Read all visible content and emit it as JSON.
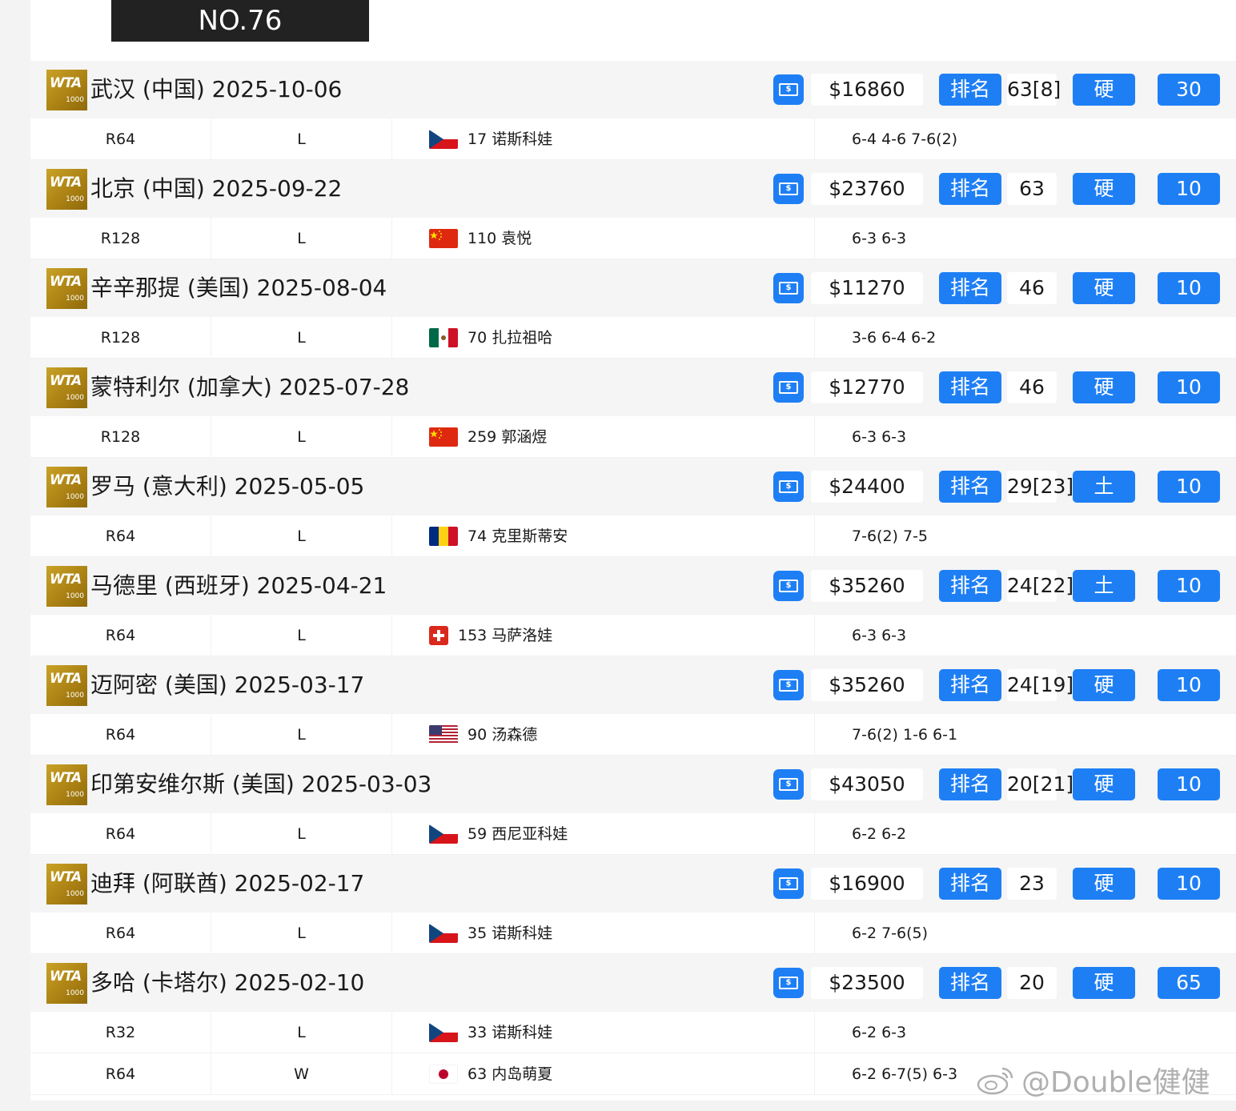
{
  "rank_badge": "NO.76",
  "logo": {
    "brand": "WTA",
    "tier": "1000"
  },
  "labels": {
    "rank": "排名"
  },
  "colors": {
    "accent": "#1e7ff5",
    "badge_bg": "#222222",
    "logo_gold": "#b8901a"
  },
  "tournaments": [
    {
      "title": "武汉 (中国) 2025-10-06",
      "prize": "$16860",
      "rank": "63[8]",
      "surface": "硬",
      "points": "30",
      "matches": [
        {
          "round": "R64",
          "result": "L",
          "flag": "cz",
          "opponent": "17 诺斯科娃",
          "score": "6-4 4-6 7-6(2)"
        }
      ]
    },
    {
      "title": "北京 (中国) 2025-09-22",
      "prize": "$23760",
      "rank": "63",
      "surface": "硬",
      "points": "10",
      "matches": [
        {
          "round": "R128",
          "result": "L",
          "flag": "cn",
          "opponent": "110 袁悦",
          "score": "6-3 6-3"
        }
      ]
    },
    {
      "title": "辛辛那提 (美国) 2025-08-04",
      "prize": "$11270",
      "rank": "46",
      "surface": "硬",
      "points": "10",
      "matches": [
        {
          "round": "R128",
          "result": "L",
          "flag": "mx",
          "opponent": "70 扎拉祖哈",
          "score": "3-6 6-4 6-2"
        }
      ]
    },
    {
      "title": "蒙特利尔 (加拿大) 2025-07-28",
      "prize": "$12770",
      "rank": "46",
      "surface": "硬",
      "points": "10",
      "matches": [
        {
          "round": "R128",
          "result": "L",
          "flag": "cn",
          "opponent": "259 郭涵煜",
          "score": "6-3 6-3"
        }
      ]
    },
    {
      "title": "罗马 (意大利) 2025-05-05",
      "prize": "$24400",
      "rank": "29[23]",
      "surface": "土",
      "points": "10",
      "matches": [
        {
          "round": "R64",
          "result": "L",
          "flag": "ro",
          "opponent": "74 克里斯蒂安",
          "score": "7-6(2) 7-5"
        }
      ]
    },
    {
      "title": "马德里 (西班牙) 2025-04-21",
      "prize": "$35260",
      "rank": "24[22]",
      "surface": "土",
      "points": "10",
      "matches": [
        {
          "round": "R64",
          "result": "L",
          "flag": "ch",
          "opponent": "153 马萨洛娃",
          "score": "6-3 6-3"
        }
      ]
    },
    {
      "title": "迈阿密 (美国) 2025-03-17",
      "prize": "$35260",
      "rank": "24[19]",
      "surface": "硬",
      "points": "10",
      "matches": [
        {
          "round": "R64",
          "result": "L",
          "flag": "us",
          "opponent": "90 汤森德",
          "score": "7-6(2) 1-6 6-1"
        }
      ]
    },
    {
      "title": "印第安维尔斯 (美国) 2025-03-03",
      "prize": "$43050",
      "rank": "20[21]",
      "surface": "硬",
      "points": "10",
      "matches": [
        {
          "round": "R64",
          "result": "L",
          "flag": "cz",
          "opponent": "59 西尼亚科娃",
          "score": "6-2 6-2"
        }
      ]
    },
    {
      "title": "迪拜 (阿联酋) 2025-02-17",
      "prize": "$16900",
      "rank": "23",
      "surface": "硬",
      "points": "10",
      "matches": [
        {
          "round": "R64",
          "result": "L",
          "flag": "cz",
          "opponent": "35 诺斯科娃",
          "score": "6-2 7-6(5)"
        }
      ]
    },
    {
      "title": "多哈 (卡塔尔) 2025-02-10",
      "prize": "$23500",
      "rank": "20",
      "surface": "硬",
      "points": "65",
      "matches": [
        {
          "round": "R32",
          "result": "L",
          "flag": "cz",
          "opponent": "33 诺斯科娃",
          "score": "6-2 6-3"
        },
        {
          "round": "R64",
          "result": "W",
          "flag": "jp",
          "opponent": "63 内岛萌夏",
          "score": "6-2 6-7(5) 6-3"
        }
      ]
    }
  ],
  "watermark": "@Double健健"
}
